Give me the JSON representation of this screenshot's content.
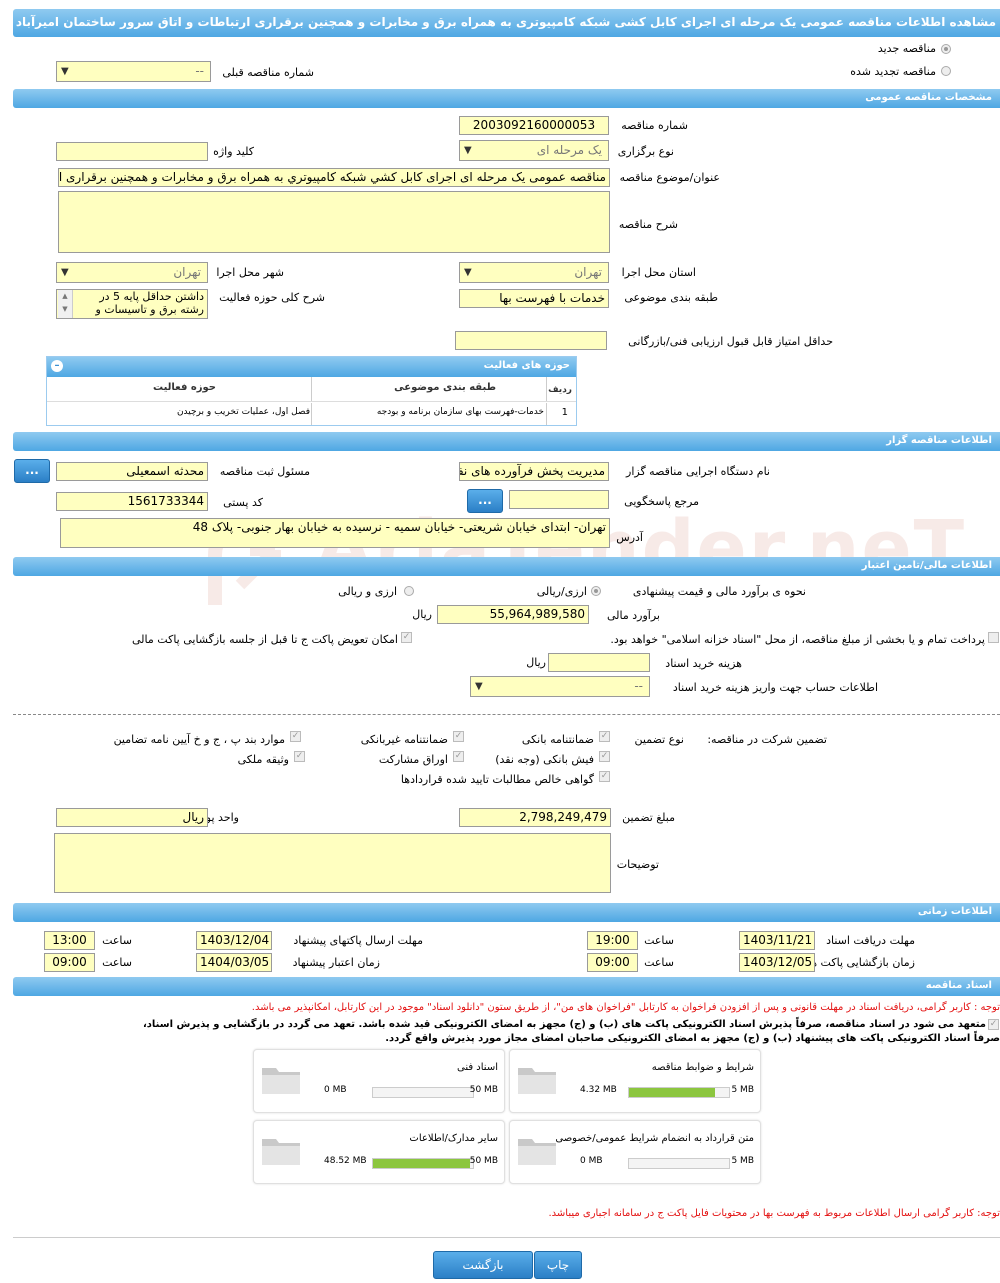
{
  "title": "مشاهده اطلاعات مناقصه عمومی یک مرحله ای اجرای کابل کشی شبکه کامپیوتری به همراه برق و مخابرات و همچنین برقراری ارتباطات و اتاق سرور ساختمان امیرآباد",
  "watermark": "AriaTender.neT",
  "type": {
    "new_label": "مناقصه جدید",
    "renewed_label": "مناقصه تجدید شده",
    "prev_number_label": "شماره مناقصه قبلی",
    "prev_number_value": "--"
  },
  "general": {
    "header": "مشخصات مناقصه عمومی",
    "number_label": "شماره مناقصه",
    "number_value": "2003092160000053",
    "holding_type_label": "نوع برگزاری",
    "holding_type_value": "یک مرحله ای",
    "keyword_label": "کلید واژه",
    "keyword_value": "",
    "subject_label": "عنوان/موضوع مناقصه",
    "subject_value": "مناقصه عمومی یک مرحله ای اجرای کابل کشي شبکه کامپیوتري به همراه برق و مخابرات و همچنین برقراری ارتباطات و اتاق سرور ساختمان امیرآباد",
    "description_label": "شرح مناقصه",
    "description_value": "",
    "province_label": "استان محل اجرا",
    "province_value": "تهران",
    "city_label": "شهر محل اجرا",
    "city_value": "تهران",
    "category_label": "طبقه بندی موضوعی",
    "category_value": "خدمات با فهرست بها",
    "activity_desc_label": "شرح کلی حوزه فعالیت",
    "activity_desc_value": "داشتن حداقل پایه 5 در رشته برق و تاسیسات و",
    "min_score_label": "حداقل امتیاز قابل قبول ارزیابی فنی/بازرگانی",
    "min_score_value": ""
  },
  "activity_table": {
    "title": "حوزه های فعالیت",
    "col_row": "ردیف",
    "col_category": "طبقه بندی موضوعی",
    "col_field": "حوزه فعالیت",
    "rows": [
      {
        "n": "1",
        "category": "خدمات-فهرست بهای سازمان برنامه و بودجه",
        "field": "فصل اول، عملیات تخریب و برچیدن"
      }
    ]
  },
  "organizer": {
    "header": "اطلاعات مناقصه گزار",
    "agency_label": "نام دستگاه اجرایی مناقصه گزار",
    "agency_value": "مدیریت پخش فرآورده های نفتی",
    "registrar_label": "مسئول ثبت مناقصه",
    "registrar_value": "محدثه اسمعیلی",
    "reference_label": "مرجع پاسخگویی",
    "reference_value": "",
    "postal_label": "کد پستی",
    "postal_value": "1561733344",
    "address_label": "آدرس",
    "address_value": "تهران- ابتدای خیابان شریعتی- خیابان سمیه - نرسیده به خیابان بهار جنوبی- پلاک 48",
    "more_button": "..."
  },
  "finance": {
    "header": "اطلاعات مالی/تامین اعتبار",
    "estimate_method_label": "نحوه ی برآورد مالی و قیمت پیشنهادی",
    "opt_currency_rial": "ارزی/ریالی",
    "opt_rial": "ارزی و ریالی",
    "estimate_label": "برآورد مالی",
    "estimate_value": "55,964,989,580",
    "estimate_unit": "ریال",
    "treasury_text": "پرداخت تمام و یا بخشی از مبلغ مناقصه، از محل \"اسناد خزانه اسلامی\" خواهد بود.",
    "swap_text": "امکان تعویض پاکت ج تا قبل از جلسه بازگشایی پاکت مالی",
    "doc_cost_label": "هزینه خرید اسناد",
    "doc_cost_value": "",
    "doc_cost_unit": "ریال",
    "account_label": "اطلاعات حساب جهت واریز هزینه خرید اسناد",
    "account_value": "--"
  },
  "guarantee": {
    "label": "تضمین شرکت در مناقصه:",
    "type_label": "نوع تضمین",
    "options": [
      "ضمانتنامه بانکی",
      "ضمانتنامه غیربانکی",
      "موارد بند پ ، ج و خ آیین نامه تضامین",
      "فیش بانکی (وجه نقد)",
      "اوراق مشارکت",
      "وثیقه ملکی",
      "گواهی خالص مطالبات تایید شده قراردادها"
    ],
    "amount_label": "مبلغ تضمین",
    "amount_value": "2,798,249,479",
    "currency_label": "واحد پول",
    "currency_value": "ریال",
    "notes_label": "توضیحات",
    "notes_value": ""
  },
  "timing": {
    "header": "اطلاعات زمانی",
    "receive_label": "مهلت دریافت اسناد",
    "receive_date": "1403/11/21",
    "receive_time": "19:00",
    "submit_label": "مهلت ارسال پاکتهای پیشنهاد",
    "submit_date": "1403/12/04",
    "submit_time": "13:00",
    "open_label": "زمان بازگشایی پاکت ها",
    "open_date": "1403/12/05",
    "open_time": "09:00",
    "validity_label": "زمان اعتبار پیشنهاد",
    "validity_date": "1404/03/05",
    "validity_time": "09:00",
    "time_label": "ساعت"
  },
  "documents": {
    "header": "اسناد مناقصه",
    "note1": "توجه : کاربر گرامی، دریافت اسناد در مهلت قانونی و پس از افزودن فراخوان به کارتابل \"فراخوان های من\"، از طریق ستون \"دانلود اسناد\" موجود در این کارتابل، امکانپذیر می باشد.",
    "commit1": "متعهد می شود در اسناد مناقصه، صرفاً پذیرش اسناد الکترونیکی پاکت های (ب) و (ج) مجهز به امضای الکترونیکی قید شده باشد. تعهد می گردد در بازگشایی و پذیرش اسناد،",
    "commit2": "صرفاً اسناد الکترونیکی پاکت های پیشنهاد (ب) و (ج) مجهز به امضای الکترونیکی صاحبان امضای مجاز مورد پذیرش واقع گردد.",
    "cards": [
      {
        "title": "شرایط و ضوابط مناقصه",
        "current": "4.32 MB",
        "max": "5 MB",
        "fill": 0.864
      },
      {
        "title": "اسناد فنی",
        "current": "0 MB",
        "max": "50 MB",
        "fill": 0
      },
      {
        "title": "متن قرارداد به انضمام شرایط عمومی/خصوصی",
        "current": "0 MB",
        "max": "5 MB",
        "fill": 0
      },
      {
        "title": "سایر مدارک/اطلاعات",
        "current": "48.52 MB",
        "max": "50 MB",
        "fill": 0.97
      }
    ],
    "note2": "توجه: کاربر گرامی ارسال اطلاعات مربوط به فهرست بها در محتویات فایل پاکت ج در سامانه اجباری میباشد."
  },
  "actions": {
    "back": "بازگشت",
    "print": "چاپ"
  }
}
